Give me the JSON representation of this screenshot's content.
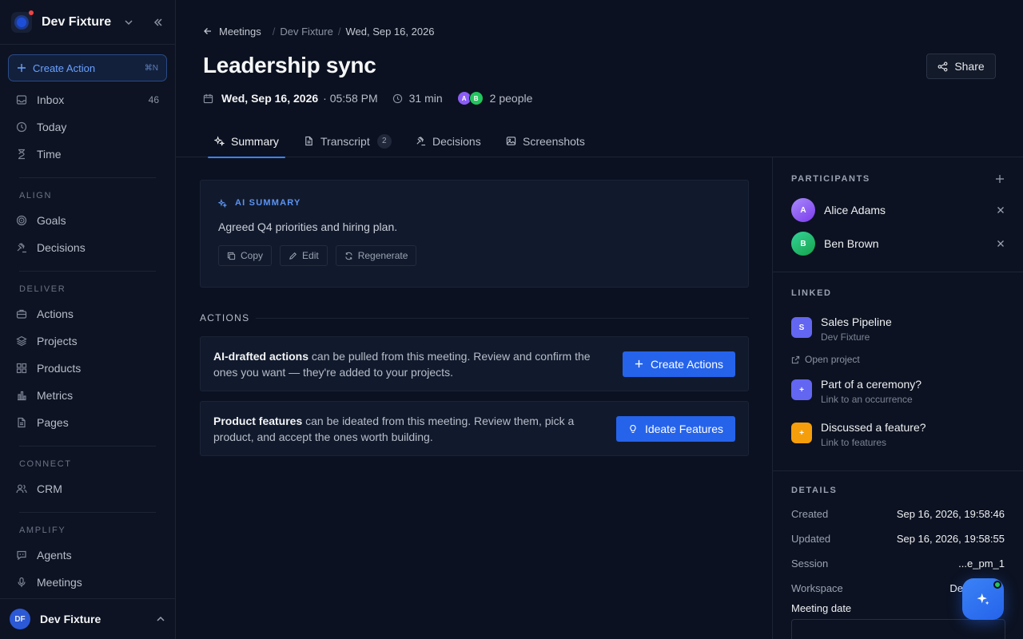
{
  "sidebar": {
    "workspace": "Dev Fixture",
    "create_action": {
      "label": "Create Action",
      "shortcut": "⌘N"
    },
    "top_items": [
      {
        "label": "Inbox",
        "count": "46",
        "icon": "inbox-icon"
      },
      {
        "label": "Today",
        "icon": "clock-icon"
      },
      {
        "label": "Time",
        "icon": "hourglass-icon"
      }
    ],
    "sections": [
      {
        "title": "ALIGN",
        "items": [
          {
            "label": "Goals",
            "icon": "target-icon"
          },
          {
            "label": "Decisions",
            "icon": "gavel-icon"
          }
        ]
      },
      {
        "title": "DELIVER",
        "items": [
          {
            "label": "Actions",
            "icon": "briefcase-icon"
          },
          {
            "label": "Projects",
            "icon": "layers-icon"
          },
          {
            "label": "Products",
            "icon": "grid-icon"
          },
          {
            "label": "Metrics",
            "icon": "bar-chart-icon"
          },
          {
            "label": "Pages",
            "icon": "file-icon"
          }
        ]
      },
      {
        "title": "CONNECT",
        "items": [
          {
            "label": "CRM",
            "icon": "users-icon"
          }
        ]
      },
      {
        "title": "AMPLIFY",
        "items": [
          {
            "label": "Agents",
            "icon": "chat-bot-icon"
          },
          {
            "label": "Meetings",
            "icon": "microphone-icon"
          }
        ]
      }
    ],
    "footer": {
      "initials": "DF",
      "name": "Dev Fixture"
    }
  },
  "breadcrumb": {
    "back": "Meetings",
    "workspace": "Dev Fixture",
    "current": "Wed, Sep 16, 2026"
  },
  "page": {
    "title": "Leadership sync",
    "share": "Share",
    "date": "Wed, Sep 16, 2026",
    "time": "· 05:58 PM",
    "duration": "31 min",
    "people": "2 people",
    "avatars": [
      "A",
      "B"
    ]
  },
  "tabs": [
    {
      "label": "Summary",
      "icon": "sparkle-icon",
      "active": true
    },
    {
      "label": "Transcript",
      "icon": "document-icon",
      "badge": "2"
    },
    {
      "label": "Decisions",
      "icon": "gavel-icon"
    },
    {
      "label": "Screenshots",
      "icon": "image-icon"
    }
  ],
  "summary": {
    "heading": "AI SUMMARY",
    "text": "Agreed Q4 priorities and hiring plan.",
    "copy": "Copy",
    "edit": "Edit",
    "regenerate": "Regenerate"
  },
  "actions": {
    "heading": "ACTIONS",
    "cards": [
      {
        "strong": "AI-drafted actions",
        "text": " can be pulled from this meeting. Review and confirm the ones you want — they're added to your projects.",
        "button": "Create Actions"
      },
      {
        "strong": "Product features",
        "text": " can be ideated from this meeting. Review them, pick a product, and accept the ones worth building.",
        "button": "Ideate Features"
      }
    ]
  },
  "participants": {
    "title": "PARTICIPANTS",
    "list": [
      {
        "initial": "A",
        "name": "Alice Adams",
        "color": "#8b5cf6"
      },
      {
        "initial": "B",
        "name": "Ben Brown",
        "color": "#22c55e"
      }
    ]
  },
  "linked": {
    "title": "LINKED",
    "project": {
      "initial": "S",
      "name": "Sales Pipeline",
      "sub": "Dev Fixture",
      "open": "Open project"
    },
    "ceremony": {
      "icon": "+",
      "name": "Part of a ceremony?",
      "sub": "Link to an occurrence"
    },
    "feature": {
      "icon": "+",
      "name": "Discussed a feature?",
      "sub": "Link to features"
    }
  },
  "details": {
    "title": "DETAILS",
    "rows": [
      {
        "k": "Created",
        "v": "Sep 16, 2026, 19:58:46"
      },
      {
        "k": "Updated",
        "v": "Sep 16, 2026, 19:58:55"
      },
      {
        "k": "Session",
        "v": "...e_pm_1"
      },
      {
        "k": "Workspace",
        "v": "De"
      }
    ],
    "meeting_date_label": "Meeting date"
  },
  "colors": {
    "accent": "#2563eb",
    "link": "#5c93f3",
    "avatar_a": "#8b5cf6",
    "avatar_b": "#22c55e",
    "linked_s": "#6366f1",
    "linked_feature": "#f59e0b"
  }
}
